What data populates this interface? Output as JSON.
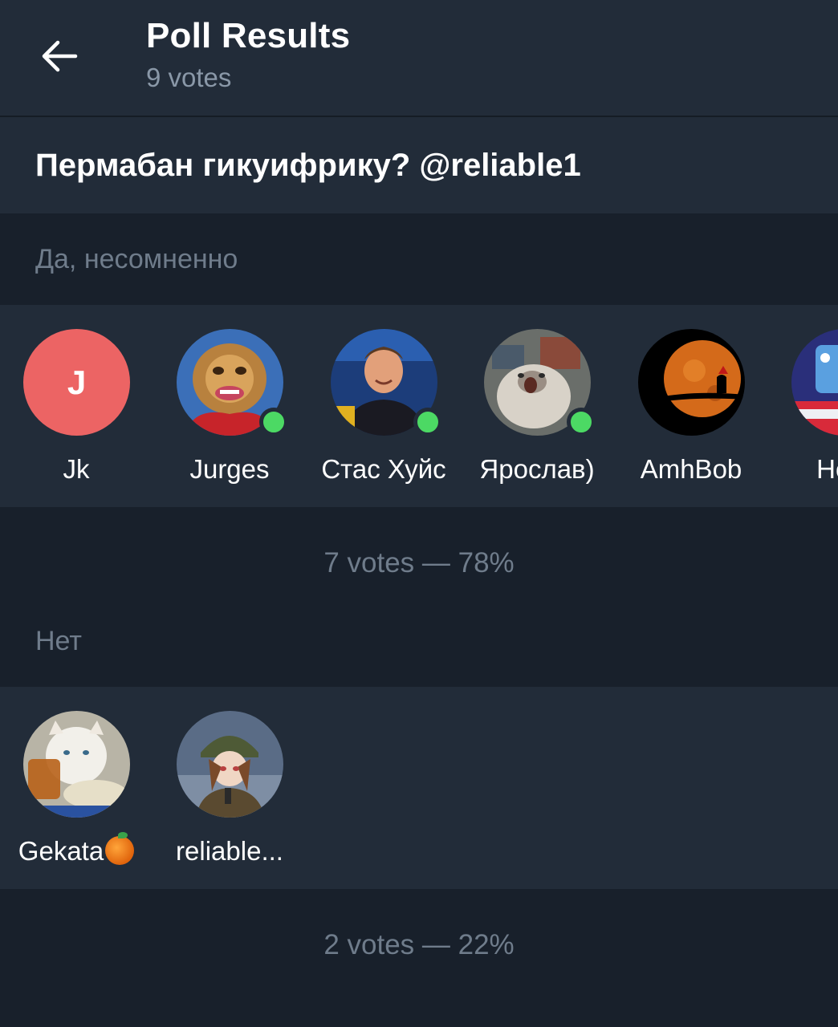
{
  "header": {
    "title": "Poll Results",
    "subtitle": "9 votes"
  },
  "question": "Пермабан гикуифрику? @reliable1",
  "options": [
    {
      "label": "Да, несомненно",
      "voters": [
        {
          "name": "Jk",
          "avatar_letter": "J",
          "avatar_color": "#ec6464",
          "online": false
        },
        {
          "name": "Jurges",
          "online": true
        },
        {
          "name": "Стас Хуйс",
          "online": true
        },
        {
          "name": "Ярослав)",
          "online": true
        },
        {
          "name": "AmhBob",
          "online": false
        },
        {
          "name": "Hom",
          "online": false
        }
      ],
      "summary": "7 votes — 78%"
    },
    {
      "label": "Нет",
      "voters": [
        {
          "name": "Gekata",
          "emoji": "orange",
          "online": false
        },
        {
          "name": "reliable...",
          "online": false
        }
      ],
      "summary": "2 votes — 22%"
    }
  ],
  "colors": {
    "background": "#18202b",
    "surface": "#222c39",
    "secondary_text": "#6f7c8b",
    "online": "#4cd964"
  }
}
